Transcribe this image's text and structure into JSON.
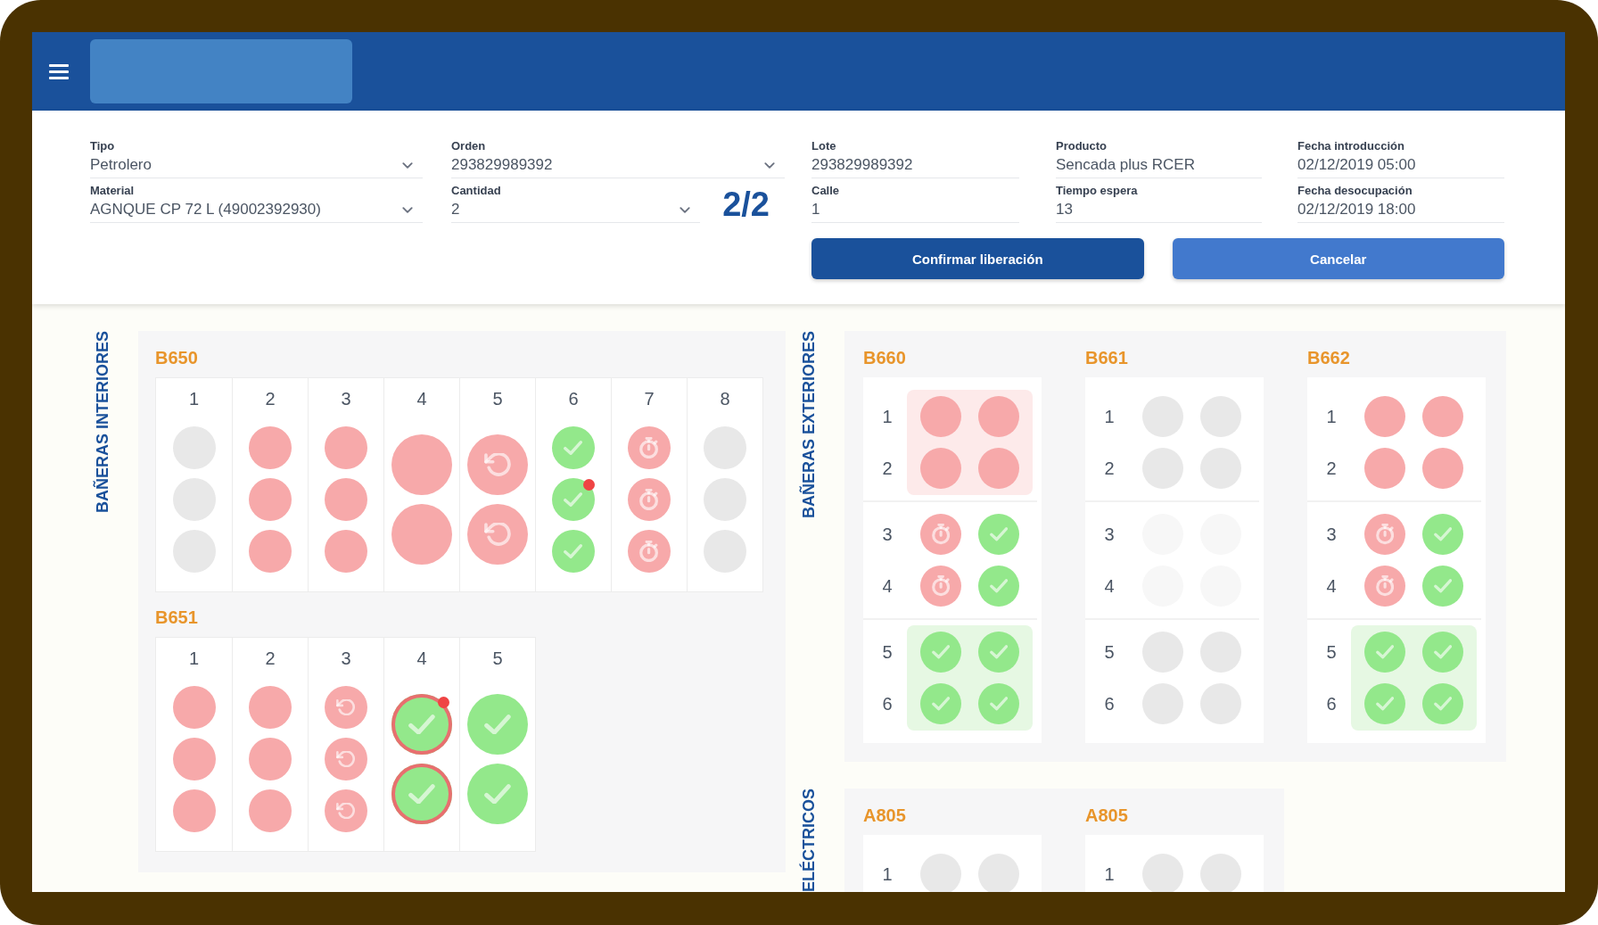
{
  "form": {
    "fields": [
      {
        "label": "Tipo",
        "value": "Petrolero",
        "kind": "select"
      },
      {
        "label": "Orden",
        "value": "293829989392",
        "kind": "select"
      },
      {
        "label": "Lote",
        "value": "293829989392",
        "kind": "text"
      },
      {
        "label": "Producto",
        "value": "Sencada plus RCER",
        "kind": "text"
      },
      {
        "label": "Fecha introducción",
        "value": "02/12/2019 05:00",
        "kind": "text"
      },
      {
        "label": "Material",
        "value": "AGNQUE CP 72 L (49002392930)",
        "kind": "select"
      },
      {
        "label": "Cantidad",
        "value": "2",
        "kind": "select",
        "counter": "2/2"
      },
      {
        "label": "Calle",
        "value": "1",
        "kind": "text"
      },
      {
        "label": "Tiempo espera",
        "value": "13",
        "kind": "text"
      },
      {
        "label": "Fecha desocupación",
        "value": "02/12/2019 18:00",
        "kind": "text"
      }
    ],
    "buttons": [
      {
        "label": "Confirmar liberación",
        "kind": "confirm"
      },
      {
        "label": "Cancelar",
        "kind": "cancel"
      }
    ]
  },
  "sections": [
    {
      "label": "BAÑERAS INTERIORES",
      "kind": "columns",
      "tanks": [
        {
          "name": "B650",
          "columns": [
            {
              "number": "1",
              "slots": [
                {
                  "kind": "empty",
                  "selected": false,
                  "alert": false
                },
                {
                  "kind": "empty",
                  "selected": false,
                  "alert": false
                },
                {
                  "kind": "empty",
                  "selected": false,
                  "alert": false
                }
              ]
            },
            {
              "number": "2",
              "slots": [
                {
                  "kind": "filled",
                  "selected": false,
                  "alert": false
                },
                {
                  "kind": "filled",
                  "selected": false,
                  "alert": false
                },
                {
                  "kind": "filled",
                  "selected": false,
                  "alert": false
                }
              ]
            },
            {
              "number": "3",
              "slots": [
                {
                  "kind": "filled",
                  "selected": false,
                  "alert": false
                },
                {
                  "kind": "filled",
                  "selected": false,
                  "alert": false
                },
                {
                  "kind": "filled",
                  "selected": false,
                  "alert": false
                }
              ]
            },
            {
              "number": "4",
              "slots": [
                {
                  "kind": "filled",
                  "selected": false,
                  "alert": false
                },
                {
                  "kind": "filled",
                  "selected": false,
                  "alert": false
                }
              ]
            },
            {
              "number": "5",
              "slots": [
                {
                  "kind": "refresh",
                  "selected": false,
                  "alert": false
                },
                {
                  "kind": "refresh",
                  "selected": false,
                  "alert": false
                }
              ]
            },
            {
              "number": "6",
              "slots": [
                {
                  "kind": "done",
                  "selected": false,
                  "alert": false
                },
                {
                  "kind": "done",
                  "selected": false,
                  "alert": true
                },
                {
                  "kind": "done",
                  "selected": false,
                  "alert": false
                }
              ]
            },
            {
              "number": "7",
              "slots": [
                {
                  "kind": "timer",
                  "selected": false,
                  "alert": false
                },
                {
                  "kind": "timer",
                  "selected": false,
                  "alert": false
                },
                {
                  "kind": "timer",
                  "selected": false,
                  "alert": false
                }
              ]
            },
            {
              "number": "8",
              "slots": [
                {
                  "kind": "empty",
                  "selected": false,
                  "alert": false
                },
                {
                  "kind": "empty",
                  "selected": false,
                  "alert": false
                },
                {
                  "kind": "empty",
                  "selected": false,
                  "alert": false
                }
              ]
            }
          ]
        },
        {
          "name": "B651",
          "columns": [
            {
              "number": "1",
              "slots": [
                {
                  "kind": "filled",
                  "selected": false,
                  "alert": false
                },
                {
                  "kind": "filled",
                  "selected": false,
                  "alert": false
                },
                {
                  "kind": "filled",
                  "selected": false,
                  "alert": false
                }
              ]
            },
            {
              "number": "2",
              "slots": [
                {
                  "kind": "filled",
                  "selected": false,
                  "alert": false
                },
                {
                  "kind": "filled",
                  "selected": false,
                  "alert": false
                },
                {
                  "kind": "filled",
                  "selected": false,
                  "alert": false
                }
              ]
            },
            {
              "number": "3",
              "slots": [
                {
                  "kind": "refresh",
                  "selected": false,
                  "alert": false
                },
                {
                  "kind": "refresh",
                  "selected": false,
                  "alert": false
                },
                {
                  "kind": "refresh",
                  "selected": false,
                  "alert": false
                }
              ]
            },
            {
              "number": "4",
              "slots": [
                {
                  "kind": "done",
                  "selected": true,
                  "alert": true
                },
                {
                  "kind": "done",
                  "selected": true,
                  "alert": false
                }
              ]
            },
            {
              "number": "5",
              "slots": [
                {
                  "kind": "done",
                  "selected": false,
                  "alert": false
                },
                {
                  "kind": "done",
                  "selected": false,
                  "alert": false
                }
              ]
            }
          ]
        }
      ]
    },
    {
      "label": "BAÑERAS EXTERIORES",
      "kind": "rows",
      "tanks": [
        {
          "name": "B660",
          "groups": [
            {
              "highlighted": true,
              "rows": [
                {
                  "number": "1",
                  "slots": [
                    {
                      "kind": "filled",
                      "selected": false,
                      "alert": false
                    },
                    {
                      "kind": "filled",
                      "selected": false,
                      "alert": false
                    }
                  ]
                },
                {
                  "number": "2",
                  "slots": [
                    {
                      "kind": "filled",
                      "selected": false,
                      "alert": false
                    },
                    {
                      "kind": "filled",
                      "selected": false,
                      "alert": false
                    }
                  ]
                }
              ]
            },
            {
              "highlighted": false,
              "rows": [
                {
                  "number": "3",
                  "slots": [
                    {
                      "kind": "timer",
                      "selected": false,
                      "alert": false
                    },
                    {
                      "kind": "done",
                      "selected": false,
                      "alert": false
                    }
                  ]
                },
                {
                  "number": "4",
                  "slots": [
                    {
                      "kind": "timer",
                      "selected": false,
                      "alert": false
                    },
                    {
                      "kind": "done",
                      "selected": false,
                      "alert": false
                    }
                  ]
                }
              ]
            },
            {
              "highlighted": true,
              "rows": [
                {
                  "number": "5",
                  "slots": [
                    {
                      "kind": "done",
                      "selected": false,
                      "alert": false
                    },
                    {
                      "kind": "done",
                      "selected": false,
                      "alert": false
                    }
                  ]
                },
                {
                  "number": "6",
                  "slots": [
                    {
                      "kind": "done",
                      "selected": false,
                      "alert": false
                    },
                    {
                      "kind": "done",
                      "selected": false,
                      "alert": false
                    }
                  ]
                }
              ]
            }
          ]
        },
        {
          "name": "B661",
          "groups": [
            {
              "highlighted": false,
              "rows": [
                {
                  "number": "1",
                  "slots": [
                    {
                      "kind": "empty",
                      "selected": false,
                      "alert": false
                    },
                    {
                      "kind": "empty",
                      "selected": false,
                      "alert": false
                    }
                  ]
                },
                {
                  "number": "2",
                  "slots": [
                    {
                      "kind": "empty",
                      "selected": false,
                      "alert": false
                    },
                    {
                      "kind": "empty",
                      "selected": false,
                      "alert": false
                    }
                  ]
                }
              ]
            },
            {
              "highlighted": false,
              "rows": [
                {
                  "number": "3",
                  "slots": [
                    {
                      "kind": "inactive",
                      "selected": false,
                      "alert": false
                    },
                    {
                      "kind": "inactive",
                      "selected": false,
                      "alert": false
                    }
                  ]
                },
                {
                  "number": "4",
                  "slots": [
                    {
                      "kind": "inactive",
                      "selected": false,
                      "alert": false
                    },
                    {
                      "kind": "inactive",
                      "selected": false,
                      "alert": false
                    }
                  ]
                }
              ]
            },
            {
              "highlighted": false,
              "rows": [
                {
                  "number": "5",
                  "slots": [
                    {
                      "kind": "empty",
                      "selected": false,
                      "alert": false
                    },
                    {
                      "kind": "empty",
                      "selected": false,
                      "alert": false
                    }
                  ]
                },
                {
                  "number": "6",
                  "slots": [
                    {
                      "kind": "empty",
                      "selected": false,
                      "alert": false
                    },
                    {
                      "kind": "empty",
                      "selected": false,
                      "alert": false
                    }
                  ]
                }
              ]
            }
          ]
        },
        {
          "name": "B662",
          "groups": [
            {
              "highlighted": false,
              "rows": [
                {
                  "number": "1",
                  "slots": [
                    {
                      "kind": "filled",
                      "selected": false,
                      "alert": false
                    },
                    {
                      "kind": "filled",
                      "selected": false,
                      "alert": false
                    }
                  ]
                },
                {
                  "number": "2",
                  "slots": [
                    {
                      "kind": "filled",
                      "selected": false,
                      "alert": false
                    },
                    {
                      "kind": "filled",
                      "selected": false,
                      "alert": false
                    }
                  ]
                }
              ]
            },
            {
              "highlighted": false,
              "rows": [
                {
                  "number": "3",
                  "slots": [
                    {
                      "kind": "timer",
                      "selected": false,
                      "alert": false
                    },
                    {
                      "kind": "done",
                      "selected": false,
                      "alert": false
                    }
                  ]
                },
                {
                  "number": "4",
                  "slots": [
                    {
                      "kind": "timer",
                      "selected": false,
                      "alert": false
                    },
                    {
                      "kind": "done",
                      "selected": false,
                      "alert": false
                    }
                  ]
                }
              ]
            },
            {
              "highlighted": true,
              "rows": [
                {
                  "number": "5",
                  "slots": [
                    {
                      "kind": "done",
                      "selected": false,
                      "alert": false
                    },
                    {
                      "kind": "done",
                      "selected": false,
                      "alert": false
                    }
                  ]
                },
                {
                  "number": "6",
                  "slots": [
                    {
                      "kind": "done",
                      "selected": false,
                      "alert": false
                    },
                    {
                      "kind": "done",
                      "selected": false,
                      "alert": false
                    }
                  ]
                }
              ]
            }
          ]
        }
      ]
    },
    {
      "label": "ELÉCTRICOS",
      "kind": "rows",
      "tanks": [
        {
          "name": "A805",
          "groups": [
            {
              "highlighted": false,
              "rows": [
                {
                  "number": "1",
                  "slots": [
                    {
                      "kind": "empty",
                      "selected": false,
                      "alert": false
                    },
                    {
                      "kind": "empty",
                      "selected": false,
                      "alert": false
                    }
                  ]
                }
              ]
            }
          ]
        },
        {
          "name": "A805",
          "groups": [
            {
              "highlighted": false,
              "rows": [
                {
                  "number": "1",
                  "slots": [
                    {
                      "kind": "empty",
                      "selected": false,
                      "alert": false
                    },
                    {
                      "kind": "empty",
                      "selected": false,
                      "alert": false
                    }
                  ]
                }
              ]
            }
          ]
        }
      ]
    }
  ]
}
